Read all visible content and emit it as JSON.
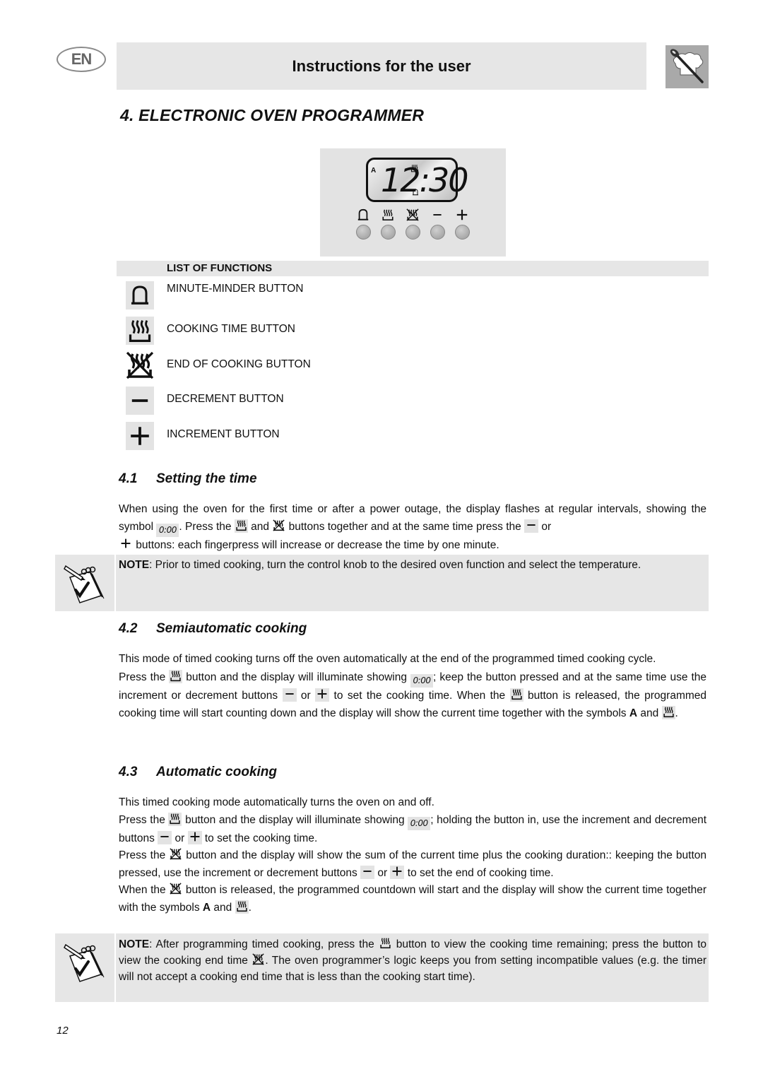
{
  "header": {
    "language_badge": "EN",
    "title": "Instructions for the user",
    "logo_icon": "chef-hat-spoon-icon"
  },
  "page_title": "4. ELECTRONIC OVEN PROGRAMMER",
  "panel": {
    "display_time": "12:30",
    "display_indicator_a": "A",
    "display_symbols": [
      "cooking-time-icon",
      "bell-icon"
    ],
    "buttons": [
      {
        "symbol": "bell-icon",
        "glyph": "bell"
      },
      {
        "symbol": "cooking-time-icon",
        "glyph": "heat"
      },
      {
        "symbol": "end-of-cooking-icon",
        "glyph": "heat-crossed"
      },
      {
        "symbol": "minus-icon",
        "glyph": "−"
      },
      {
        "symbol": "plus-icon",
        "glyph": "+"
      }
    ]
  },
  "list_of_functions": {
    "title": "LIST OF FUNCTIONS",
    "items": [
      {
        "icon": "bell-icon",
        "label": "MINUTE-MINDER BUTTON"
      },
      {
        "icon": "cooking-time-icon",
        "label": "COOKING TIME BUTTON"
      },
      {
        "icon": "end-of-cooking-icon",
        "label": "END OF COOKING BUTTON"
      },
      {
        "icon": "minus-icon",
        "label": "DECREMENT BUTTON"
      },
      {
        "icon": "plus-icon",
        "label": "INCREMENT BUTTON"
      }
    ]
  },
  "sections": {
    "s41": {
      "number": "4.1",
      "title": "Setting the time",
      "p1_a": "When using the oven for the first time or after a power outage, the display flashes at regular intervals, showing the symbol ",
      "lcd_symbol": "0:00",
      "p1_b": ". Press the ",
      "p1_c": " and ",
      "p1_d": " buttons together and at the same time press the ",
      "p1_e": " or ",
      "p1_f": " buttons: each fingerpress will increase or decrease the time by one minute.",
      "note_label": "NOTE",
      "note_text": ": Prior to timed cooking, turn the control knob to the desired oven function and select the temperature."
    },
    "s42": {
      "number": "4.2",
      "title": "Semiautomatic cooking",
      "p1": "This mode of timed cooking turns off the oven automatically at the end of the programmed timed cooking cycle.",
      "p2_a": "Press the ",
      "p2_b": " button and the display will illuminate showing ",
      "lcd_symbol": "0:00",
      "p2_c": "; keep the button pressed and at the same time use the increment or decrement buttons ",
      "p2_d": " or ",
      "p2_e": " to set the cooking time. When the ",
      "p2_f": " button is released, the programmed cooking time will start counting down and the display will show the current time together with the symbols ",
      "symbol_a": "A",
      "p2_g": " and ",
      "p2_h": "."
    },
    "s43": {
      "number": "4.3",
      "title": "Automatic cooking",
      "p1": "This timed cooking mode automatically turns the oven on and off.",
      "p2_a": "Press the ",
      "p2_b": " button and the display will illuminate showing ",
      "lcd_symbol": "0:00",
      "p2_c": "; holding the button in, use the increment and decrement buttons ",
      "p2_d": " or ",
      "p2_e": " to set the cooking time.",
      "p3_a": "Press the ",
      "p3_b": " button and the display will show the sum of the current time plus the cooking duration:: keeping the button pressed, use the increment or decrement buttons ",
      "p3_c": " or ",
      "p3_d": " to set the end of cooking time.",
      "p4_a": "When the ",
      "p4_b": " button is released, the programmed countdown will start and the display will show the current time together with the symbols ",
      "symbol_a": "A",
      "p4_c": " and ",
      "p4_d": ".",
      "note_label": "NOTE",
      "note_a": ": After programming timed cooking, press the ",
      "note_b": " button to view the cooking time remaining; press the button to view the cooking end time ",
      "note_c": ". The oven programmer’s logic keeps you from setting incompatible values (e.g. the timer will not accept a cooking end time that is less than the cooking start time)."
    }
  },
  "note_icon": "notepad-check-icon",
  "page_number": "12"
}
